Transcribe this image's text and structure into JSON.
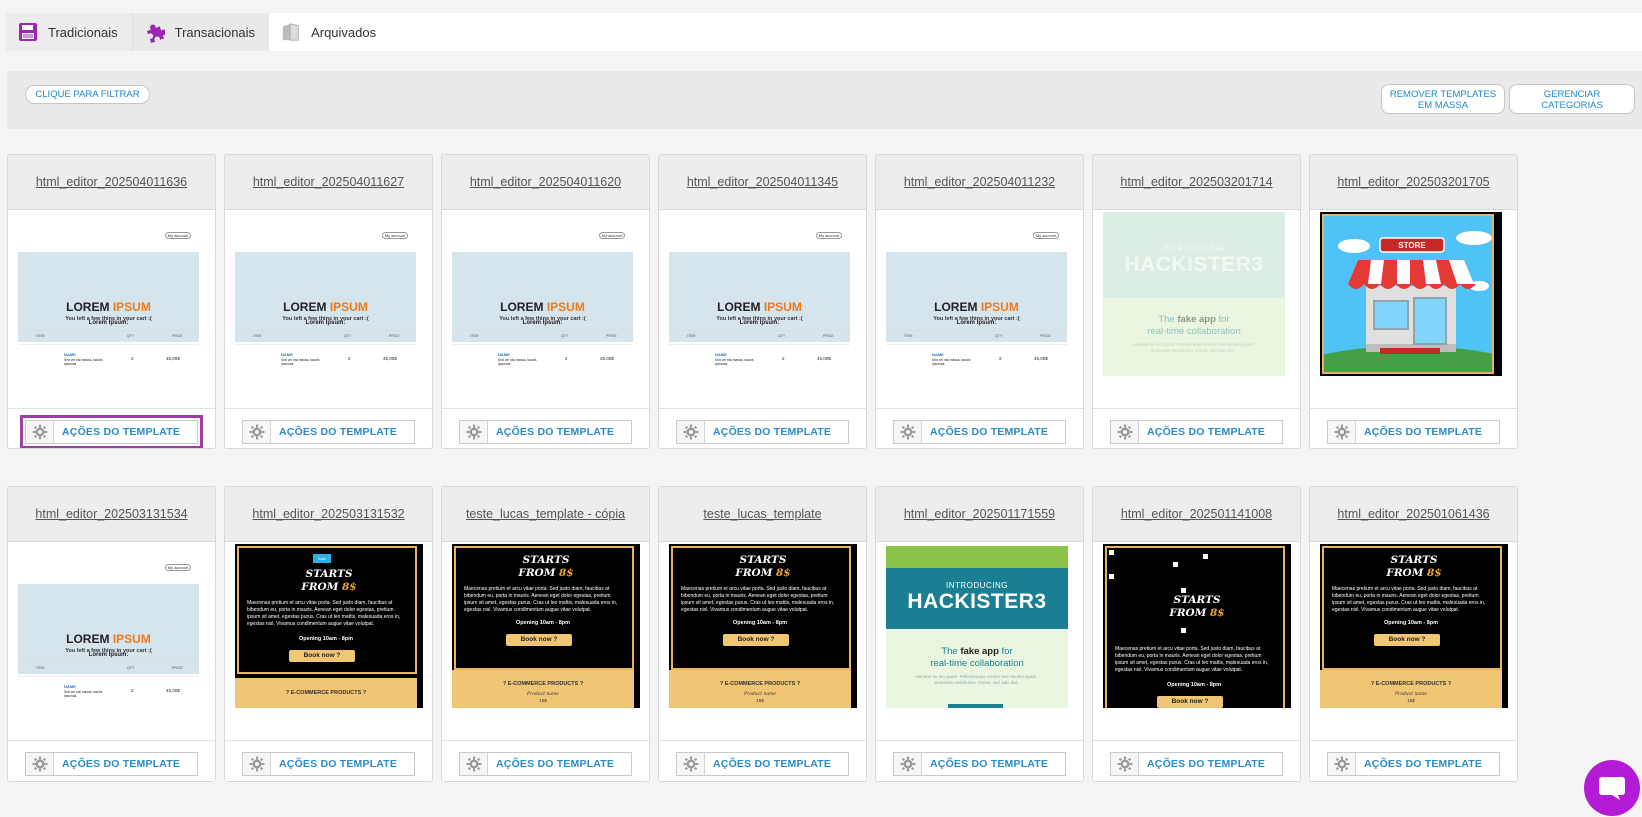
{
  "tabs": [
    {
      "label": "Tradicionais",
      "icon": "save-icon",
      "color": "#9c27b0"
    },
    {
      "label": "Transacionais",
      "icon": "puzzle-icon",
      "color": "#9c27b0"
    },
    {
      "label": "Arquivados",
      "icon": "archive-icon",
      "color": "#888888"
    }
  ],
  "filter": {
    "filter_button": "CLIQUE PARA FILTRAR",
    "remove_button": "REMOVER TEMPLATES EM MASSA",
    "remove_line1": "REMOVER TEMPLATES",
    "remove_line2": "EM MASSA",
    "manage_button": "GERENCIAR CATEGORIAS",
    "manage_line1": "GERENCIAR",
    "manage_line2": "CATEGORIAS"
  },
  "action_label": "AÇÕES DO TEMPLATE",
  "templates": [
    {
      "title": "html_editor_202504011636",
      "thumb": "lorem"
    },
    {
      "title": "html_editor_202504011627",
      "thumb": "lorem"
    },
    {
      "title": "html_editor_202504011620",
      "thumb": "lorem"
    },
    {
      "title": "html_editor_202504011345",
      "thumb": "lorem"
    },
    {
      "title": "html_editor_202504011232",
      "thumb": "lorem"
    },
    {
      "title": "html_editor_202503201714",
      "thumb": "hackister-faded"
    },
    {
      "title": "html_editor_202503201705",
      "thumb": "store"
    },
    {
      "title": "html_editor_202503131534",
      "thumb": "lorem"
    },
    {
      "title": "html_editor_202503131532",
      "thumb": "starts-badge"
    },
    {
      "title": "teste_lucas_template - cópia",
      "thumb": "starts"
    },
    {
      "title": "teste_lucas_template",
      "thumb": "starts"
    },
    {
      "title": "html_editor_202501171559",
      "thumb": "hackister"
    },
    {
      "title": "html_editor_202501141008",
      "thumb": "starts-broken"
    },
    {
      "title": "html_editor_202501061436",
      "thumb": "starts"
    }
  ],
  "thumbs": {
    "lorem": {
      "account": "My account",
      "headline_a": "LOREM",
      "headline_b": "IPSUM",
      "subline": "You left a few thins in your cart :(",
      "section": "Lorem Ipsum:",
      "col_item": "ITEM",
      "col_qty": "QTY",
      "col_price": "PRICE",
      "name": "NAME",
      "desc": "Sed vel nisi massa, iaculis ipsumas.",
      "qty": "2",
      "price": "45,00$"
    },
    "hackister": {
      "intro": "INTRODUCING",
      "brand": "HACKISTER3",
      "tag_a": "The",
      "tag_b": "fake app",
      "tag_c": "for",
      "tag_d": "real-time collaboration",
      "small": "Aenean eu leo quam. Pellentesque ornare sem lacinia quam venenatis vestibulum. Donec sed odio dui."
    },
    "starts": {
      "line1": "STARTS",
      "line2": "FROM",
      "price": "8$",
      "text": "Maecenas pretium et arcu vitae porta. Sed justo diam, faucibus at bibendum eu, porta in mauris. Aenean eget dolor egestas, pretium ipsum sit amet, egestas purus. Cras ut leo mattis, malesuada eros in, egestas nisl. Vivamus condimentum augue vitae volutpat.",
      "hours": "Opening 10am - 8pm",
      "book": "Book now ?",
      "footer": "? E-COMMERCE PRODUCTS ?",
      "product": "Product name",
      "product_price": "15$",
      "badge": "Sale"
    },
    "store": {
      "sign": "STORE"
    }
  },
  "colors": {
    "accent": "#2a8bc6",
    "highlight": "#9b3ea6",
    "chat": "#b31bd6",
    "gold": "#f0c574",
    "teal": "#1a7f92"
  }
}
